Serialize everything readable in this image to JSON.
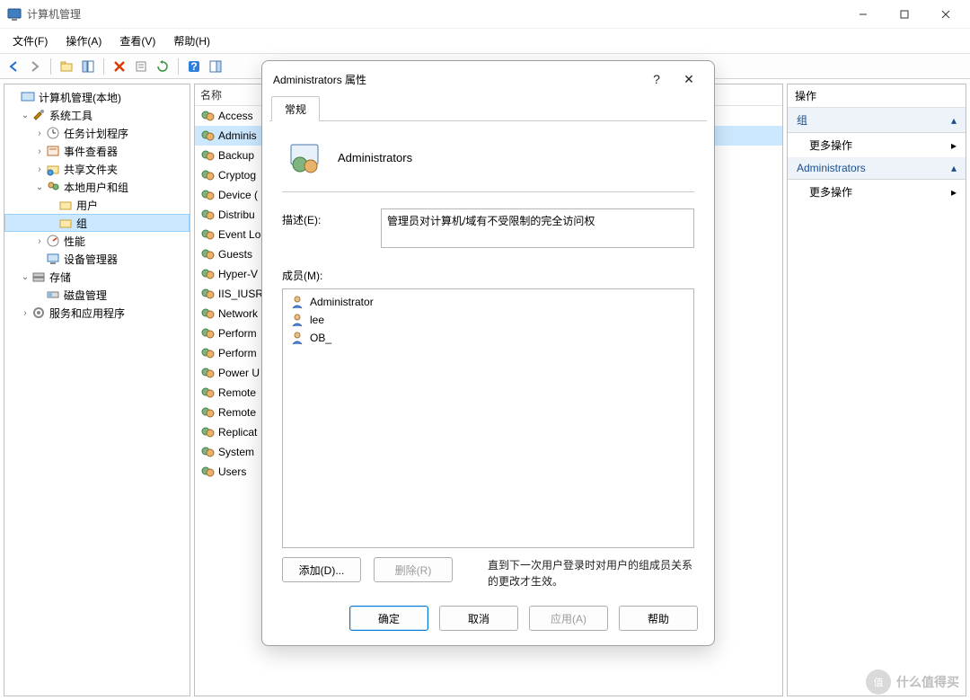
{
  "window": {
    "title": "计算机管理"
  },
  "menu": {
    "file": "文件(F)",
    "action": "操作(A)",
    "view": "查看(V)",
    "help": "帮助(H)"
  },
  "tree": {
    "root": "计算机管理(本地)",
    "systools": "系统工具",
    "tasksched": "任务计划程序",
    "eventvwr": "事件查看器",
    "shared": "共享文件夹",
    "lusrgrp": "本地用户和组",
    "users": "用户",
    "groups": "组",
    "perf": "性能",
    "devmgr": "设备管理器",
    "storage": "存储",
    "diskmgr": "磁盘管理",
    "svcapps": "服务和应用程序"
  },
  "list": {
    "header": "名称",
    "items": [
      "Access",
      "Adminis",
      "Backup",
      "Cryptog",
      "Device (",
      "Distribu",
      "Event Lo",
      "Guests",
      "Hyper-V",
      "IIS_IUSR",
      "Network",
      "Perform",
      "Perform",
      "Power U",
      "Remote",
      "Remote",
      "Replicat",
      "System",
      "Users"
    ]
  },
  "actions": {
    "header": "操作",
    "cat1": "组",
    "cat2": "Administrators",
    "more": "更多操作"
  },
  "dialog": {
    "title": "Administrators 属性",
    "tab_general": "常规",
    "group_name": "Administrators",
    "desc_label": "描述(E):",
    "desc_value": "管理员对计算机/域有不受限制的完全访问权",
    "members_label": "成员(M):",
    "members": [
      "Administrator",
      "lee",
      "OB_"
    ],
    "add": "添加(D)...",
    "remove": "删除(R)",
    "note": "直到下一次用户登录时对用户的组成员关系的更改才生效。",
    "ok": "确定",
    "cancel": "取消",
    "apply": "应用(A)",
    "help": "帮助"
  },
  "watermark": {
    "badge": "值",
    "text": "什么值得买"
  }
}
